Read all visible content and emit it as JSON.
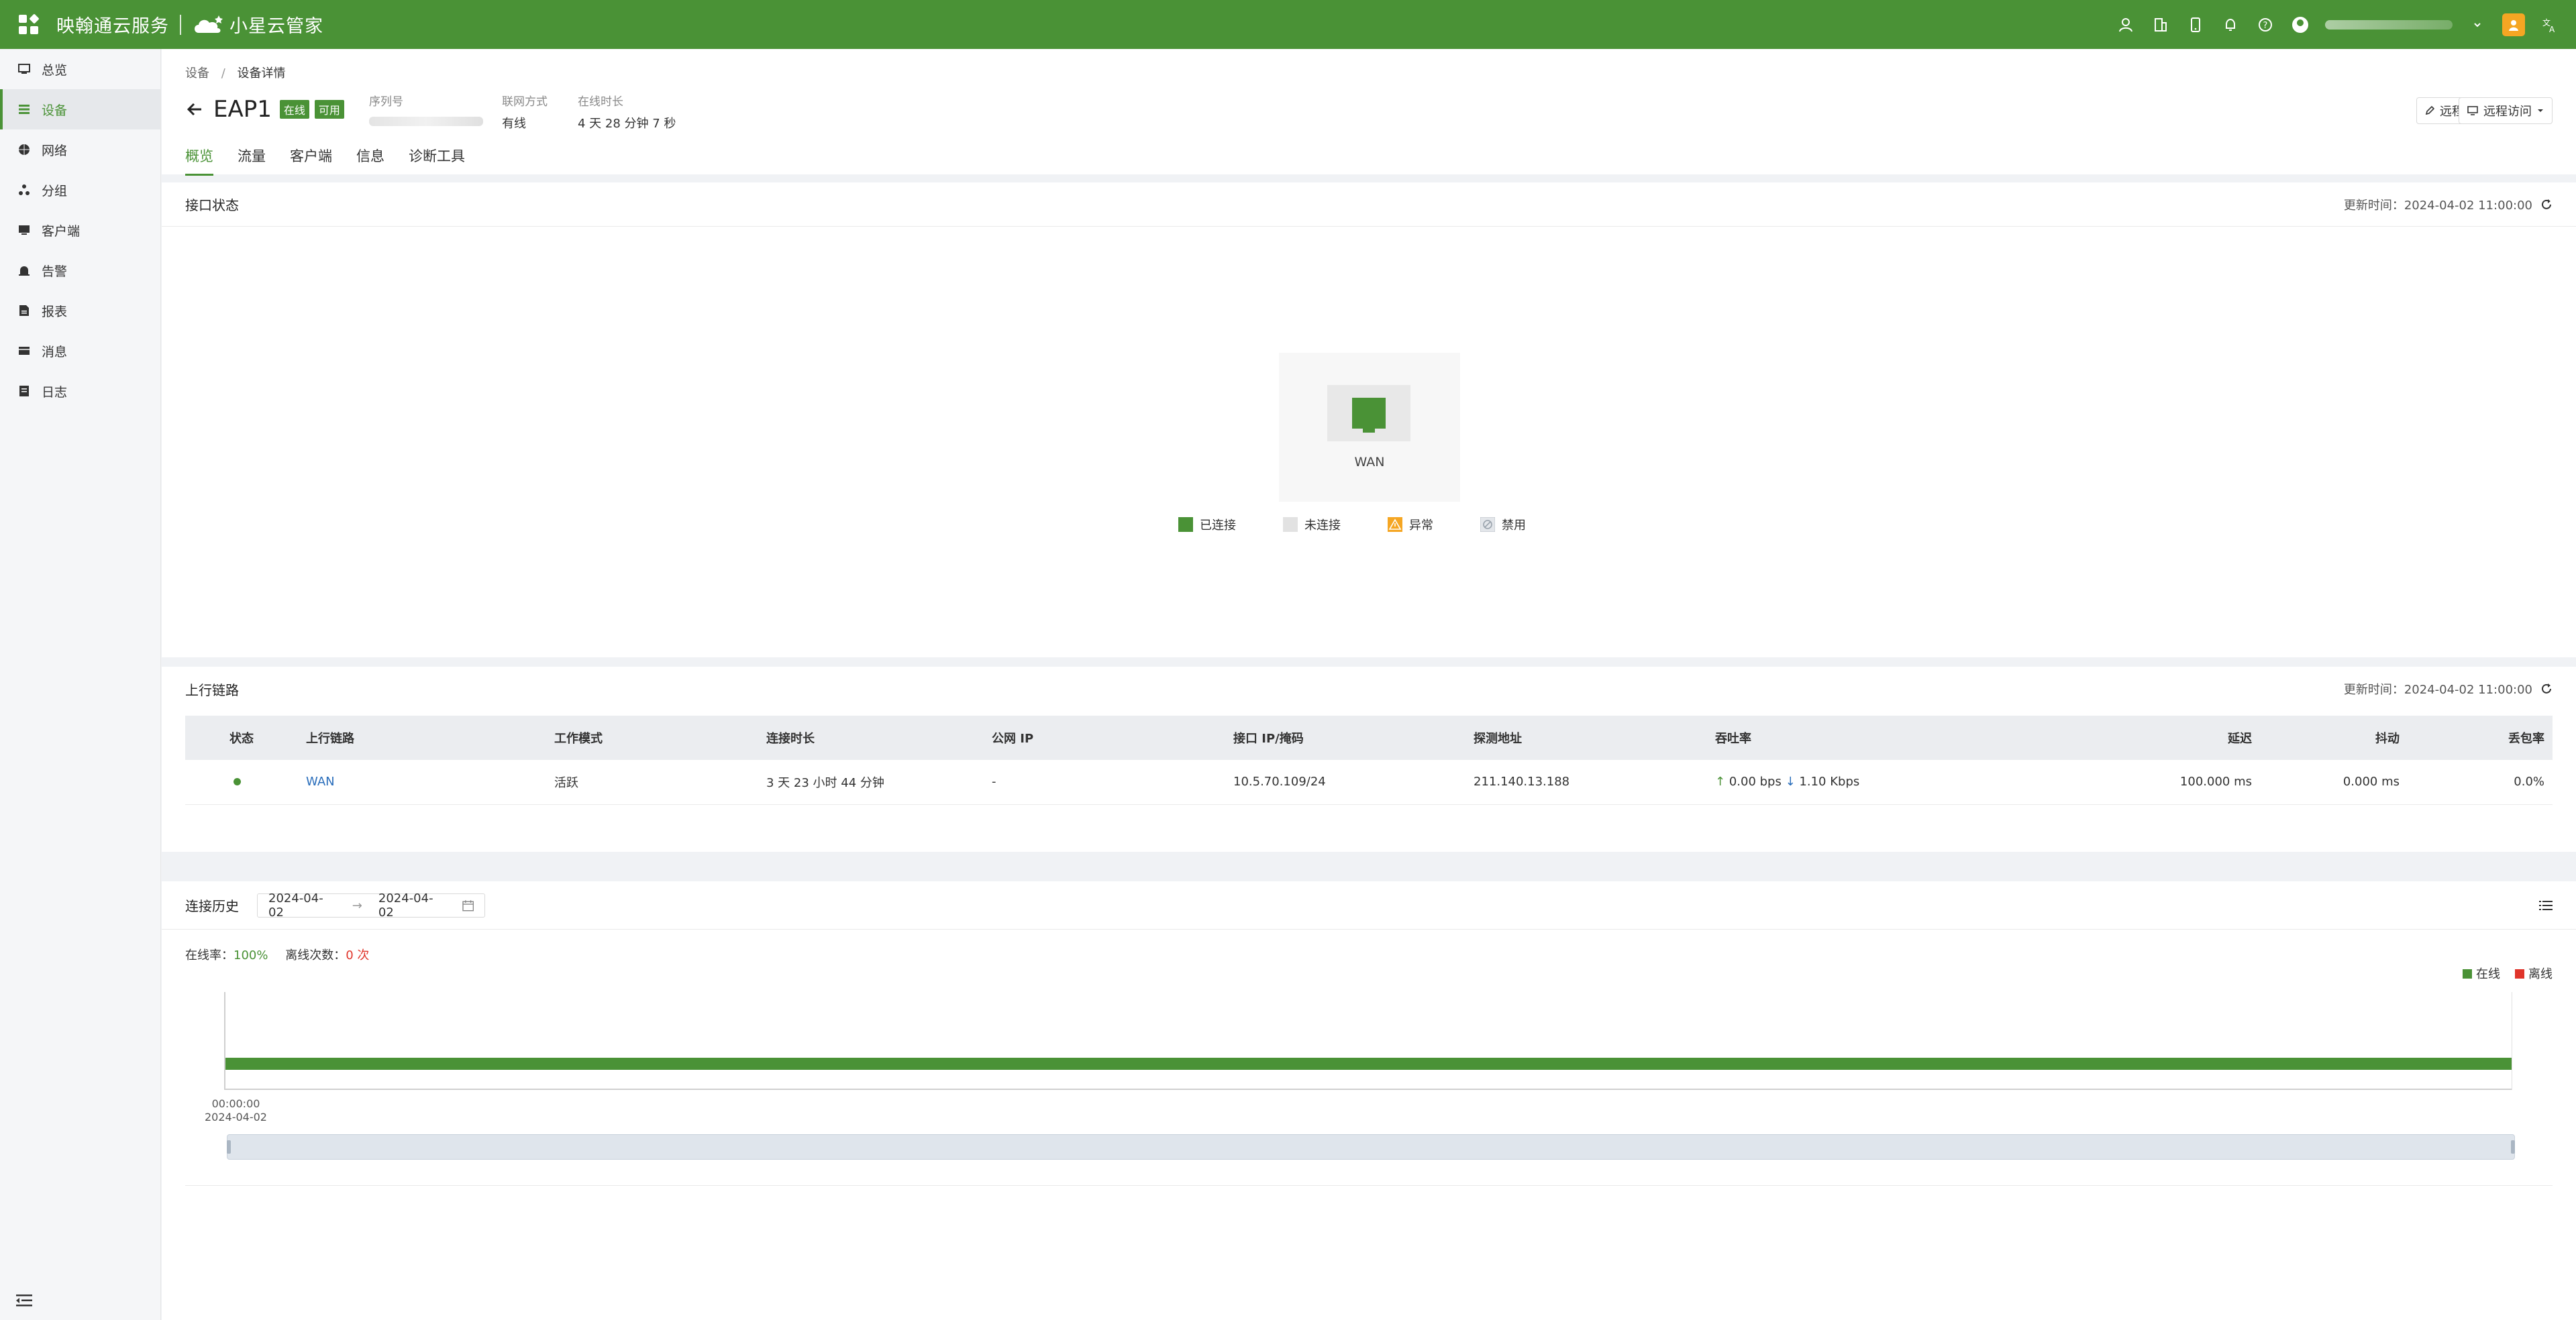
{
  "app": {
    "brand": "映翰通云服务",
    "brand2": "小星云管家"
  },
  "sidebar": {
    "items": [
      {
        "label": "总览",
        "icon": "dashboard-icon",
        "active": false
      },
      {
        "label": "设备",
        "icon": "device-list-icon",
        "active": true
      },
      {
        "label": "网络",
        "icon": "globe-icon",
        "active": false
      },
      {
        "label": "分组",
        "icon": "group-icon",
        "active": false
      },
      {
        "label": "客户端",
        "icon": "client-icon",
        "active": false
      },
      {
        "label": "告警",
        "icon": "alarm-icon",
        "active": false
      },
      {
        "label": "报表",
        "icon": "report-icon",
        "active": false
      },
      {
        "label": "消息",
        "icon": "message-icon",
        "active": false
      },
      {
        "label": "日志",
        "icon": "log-icon",
        "active": false
      }
    ]
  },
  "breadcrumb": {
    "root": "设备",
    "separator": "/",
    "current": "设备详情"
  },
  "device": {
    "name": "EAP1",
    "badge_status": "在线",
    "badge_usable": "可用",
    "serial_label": "序列号",
    "conn_label": "联网方式",
    "conn_value": "有线",
    "uptime_label": "在线时长",
    "uptime_value": "4 天 28 分钟 7 秒"
  },
  "header_buttons": {
    "remote_config": "远程配置",
    "remote_access": "远程访问"
  },
  "tabs": [
    "概览",
    "流量",
    "客户端",
    "信息",
    "诊断工具"
  ],
  "interface_status": {
    "title": "接口状态",
    "updated": "更新时间：2024-04-02 11:00:00",
    "port_label": "WAN",
    "legend": [
      {
        "label": "已连接",
        "color": "#4a9236"
      },
      {
        "label": "未连接",
        "color": "#e2e2e2"
      },
      {
        "label": "异常",
        "color": "#f5a623"
      },
      {
        "label": "禁用",
        "color": "#cfd3d8"
      }
    ]
  },
  "uplink": {
    "title": "上行链路",
    "updated": "更新时间：2024-04-02 11:00:00",
    "columns": [
      "状态",
      "上行链路",
      "工作模式",
      "连接时长",
      "公网 IP",
      "接口 IP/掩码",
      "探测地址",
      "吞吐率",
      "延迟",
      "抖动",
      "丢包率"
    ],
    "row": {
      "link": "WAN",
      "mode": "活跃",
      "duration": "3 天 23 小时 44 分钟",
      "public_ip": "-",
      "iface_ip": "10.5.70.109/24",
      "probe": "211.140.13.188",
      "tx": "0.00 bps",
      "rx": "1.10 Kbps",
      "latency": "100.000 ms",
      "jitter": "0.000 ms",
      "loss": "0.0%"
    }
  },
  "history": {
    "title": "连接历史",
    "date_from": "2024-04-02",
    "date_to": "2024-04-02",
    "arrow": "→",
    "online_rate_label": "在线率：",
    "online_rate": "100%",
    "offline_count_label": "离线次数：",
    "offline_count": "0 次",
    "legend_online": "在线",
    "legend_offline": "离线",
    "color_online": "#4a9236",
    "color_offline": "#e0352b",
    "tick_time": "00:00:00",
    "tick_date": "2024-04-02",
    "online_segments": [
      {
        "start_fraction": 0.0,
        "end_fraction": 1.0
      }
    ]
  }
}
